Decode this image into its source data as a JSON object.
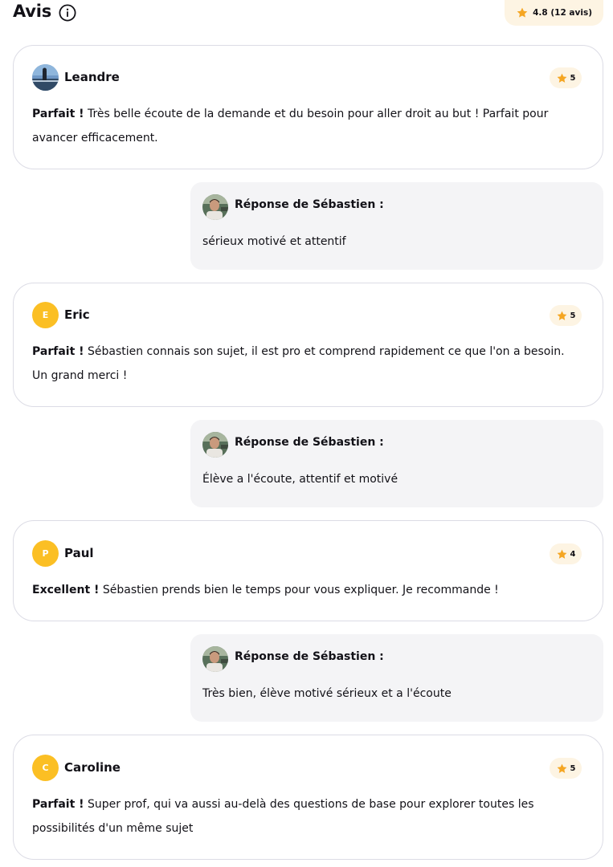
{
  "header": {
    "title": "Avis",
    "rating_summary": "4.8 (12 avis)"
  },
  "colors": {
    "accent": "#fbbf24",
    "badge_bg": "#fdf4e3",
    "reply_bg": "#f4f4f6"
  },
  "reviews": [
    {
      "author": "Leandre",
      "avatar_type": "photo",
      "avatar_letter": "",
      "rating": "5",
      "headline": "Parfait !",
      "text": "Très belle écoute de la demande et du besoin pour aller droit au but ! Parfait pour avancer efficacement.",
      "reply_title": "Réponse de Sébastien :",
      "reply_text": "sérieux motivé et attentif"
    },
    {
      "author": "Eric",
      "avatar_type": "letter",
      "avatar_letter": "E",
      "rating": "5",
      "headline": "Parfait !",
      "text": "Sébastien connais son sujet, il est pro et comprend rapidement ce que l'on a besoin. Un grand merci !",
      "reply_title": "Réponse de Sébastien :",
      "reply_text": "Élève a l'écoute, attentif et motivé"
    },
    {
      "author": "Paul",
      "avatar_type": "letter",
      "avatar_letter": "P",
      "rating": "4",
      "headline": "Excellent !",
      "text": "Sébastien prends bien le temps pour vous expliquer. Je recommande !",
      "reply_title": "Réponse de Sébastien :",
      "reply_text": "Très bien, élève motivé sérieux et a l'écoute"
    },
    {
      "author": "Caroline",
      "avatar_type": "letter",
      "avatar_letter": "C",
      "rating": "5",
      "headline": "Parfait !",
      "text": "Super prof, qui va aussi au-delà des questions de base pour explorer toutes les possibilités d'un même sujet",
      "reply_title": "",
      "reply_text": ""
    }
  ]
}
